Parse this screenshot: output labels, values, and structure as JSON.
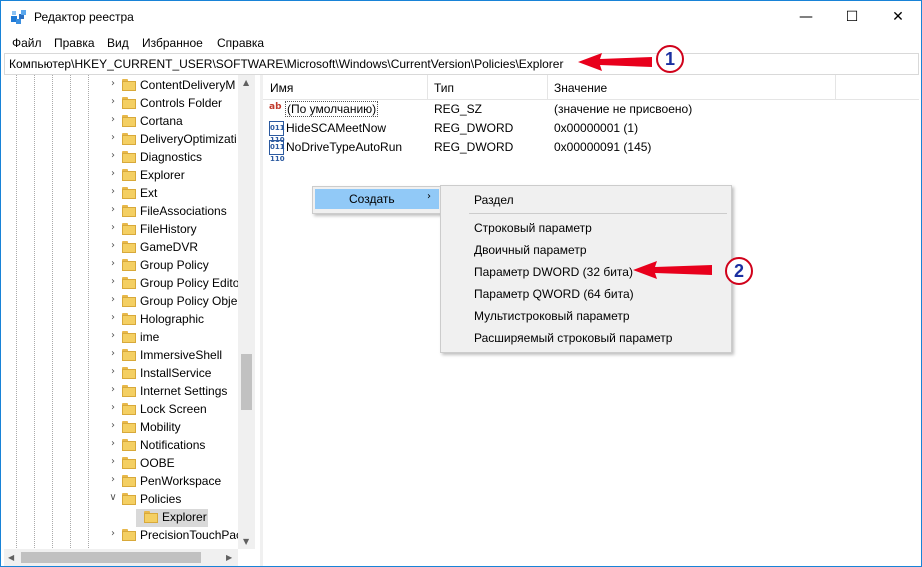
{
  "window": {
    "title": "Редактор реестра",
    "controls": {
      "minimize": "—",
      "maximize": "☐",
      "close": "✕"
    }
  },
  "menu": [
    "Файл",
    "Правка",
    "Вид",
    "Избранное",
    "Справка"
  ],
  "address": "Компьютер\\HKEY_CURRENT_USER\\SOFTWARE\\Microsoft\\Windows\\CurrentVersion\\Policies\\Explorer",
  "tree": {
    "items": [
      "ContentDeliveryM",
      "Controls Folder",
      "Cortana",
      "DeliveryOptimizati",
      "Diagnostics",
      "Explorer",
      "Ext",
      "FileAssociations",
      "FileHistory",
      "GameDVR",
      "Group Policy",
      "Group Policy Edito",
      "Group Policy Obje",
      "Holographic",
      "ime",
      "ImmersiveShell",
      "InstallService",
      "Internet Settings",
      "Lock Screen",
      "Mobility",
      "Notifications",
      "OOBE",
      "PenWorkspace",
      "Policies"
    ],
    "child": "Explorer",
    "last": "PrecisionTouchPac"
  },
  "list": {
    "columns": [
      "Имя",
      "Тип",
      "Значение"
    ],
    "rows": [
      {
        "icon": "string-value-icon",
        "name": "(По умолчанию)",
        "type": "REG_SZ",
        "value": "(значение не присвоено)"
      },
      {
        "icon": "binary-value-icon",
        "name": "HideSCAMeetNow",
        "type": "REG_DWORD",
        "value": "0x00000001 (1)"
      },
      {
        "icon": "binary-value-icon",
        "name": "NoDriveTypeAutoRun",
        "type": "REG_DWORD",
        "value": "0x00000091 (145)"
      }
    ]
  },
  "context_menu": {
    "create_label": "Создать",
    "submenu_arrow": "›",
    "submenu": [
      "Раздел",
      "Строковый параметр",
      "Двоичный параметр",
      "Параметр DWORD (32 бита)",
      "Параметр QWORD (64 бита)",
      "Мультистроковый параметр",
      "Расширяемый строковый параметр"
    ]
  },
  "callouts": [
    "1",
    "2"
  ],
  "colors": {
    "annotation_red": "#e8001c",
    "highlight": "#91c9f7",
    "border": "#1883d7"
  }
}
